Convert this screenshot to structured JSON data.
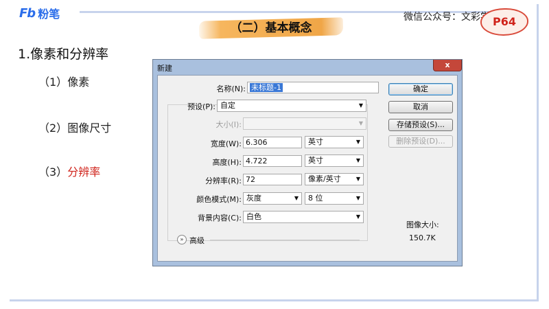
{
  "header": {
    "logo_fb": "Fb",
    "logo_text": "粉笔",
    "section_title": "（二）基本概念",
    "wechat": "微信公众号：文彩学社",
    "page_badge": "P64"
  },
  "content": {
    "heading": "1.像素和分辨率",
    "items": [
      {
        "num": "（1）",
        "text": "像素"
      },
      {
        "num": "（2）",
        "text": "图像尺寸"
      },
      {
        "num": "（3）",
        "text": "分辨率"
      }
    ]
  },
  "dialog": {
    "title": "新建",
    "close": "x",
    "name_label": "名称(N):",
    "name_value": "未标题-1",
    "preset_label": "预设(P):",
    "preset_value": "自定",
    "size_label": "大小(I):",
    "size_value": "",
    "width_label": "宽度(W):",
    "width_value": "6.306",
    "width_unit": "英寸",
    "height_label": "高度(H):",
    "height_value": "4.722",
    "height_unit": "英寸",
    "resolution_label": "分辨率(R):",
    "resolution_value": "72",
    "resolution_unit": "像素/英寸",
    "colormode_label": "颜色模式(M):",
    "colormode_value": "灰度",
    "bitdepth_value": "8 位",
    "background_label": "背景内容(C):",
    "background_value": "白色",
    "advanced_label": "高级",
    "buttons": {
      "ok": "确定",
      "cancel": "取消",
      "save_preset": "存储预设(S)...",
      "delete_preset": "删除预设(D)..."
    },
    "image_size_label": "图像大小:",
    "image_size_value": "150.7K"
  },
  "colors": {
    "accent": "#2b6dea",
    "red": "#d0231b",
    "title_brush": "#f0a647",
    "dialog_frame": "#a9c0de"
  }
}
